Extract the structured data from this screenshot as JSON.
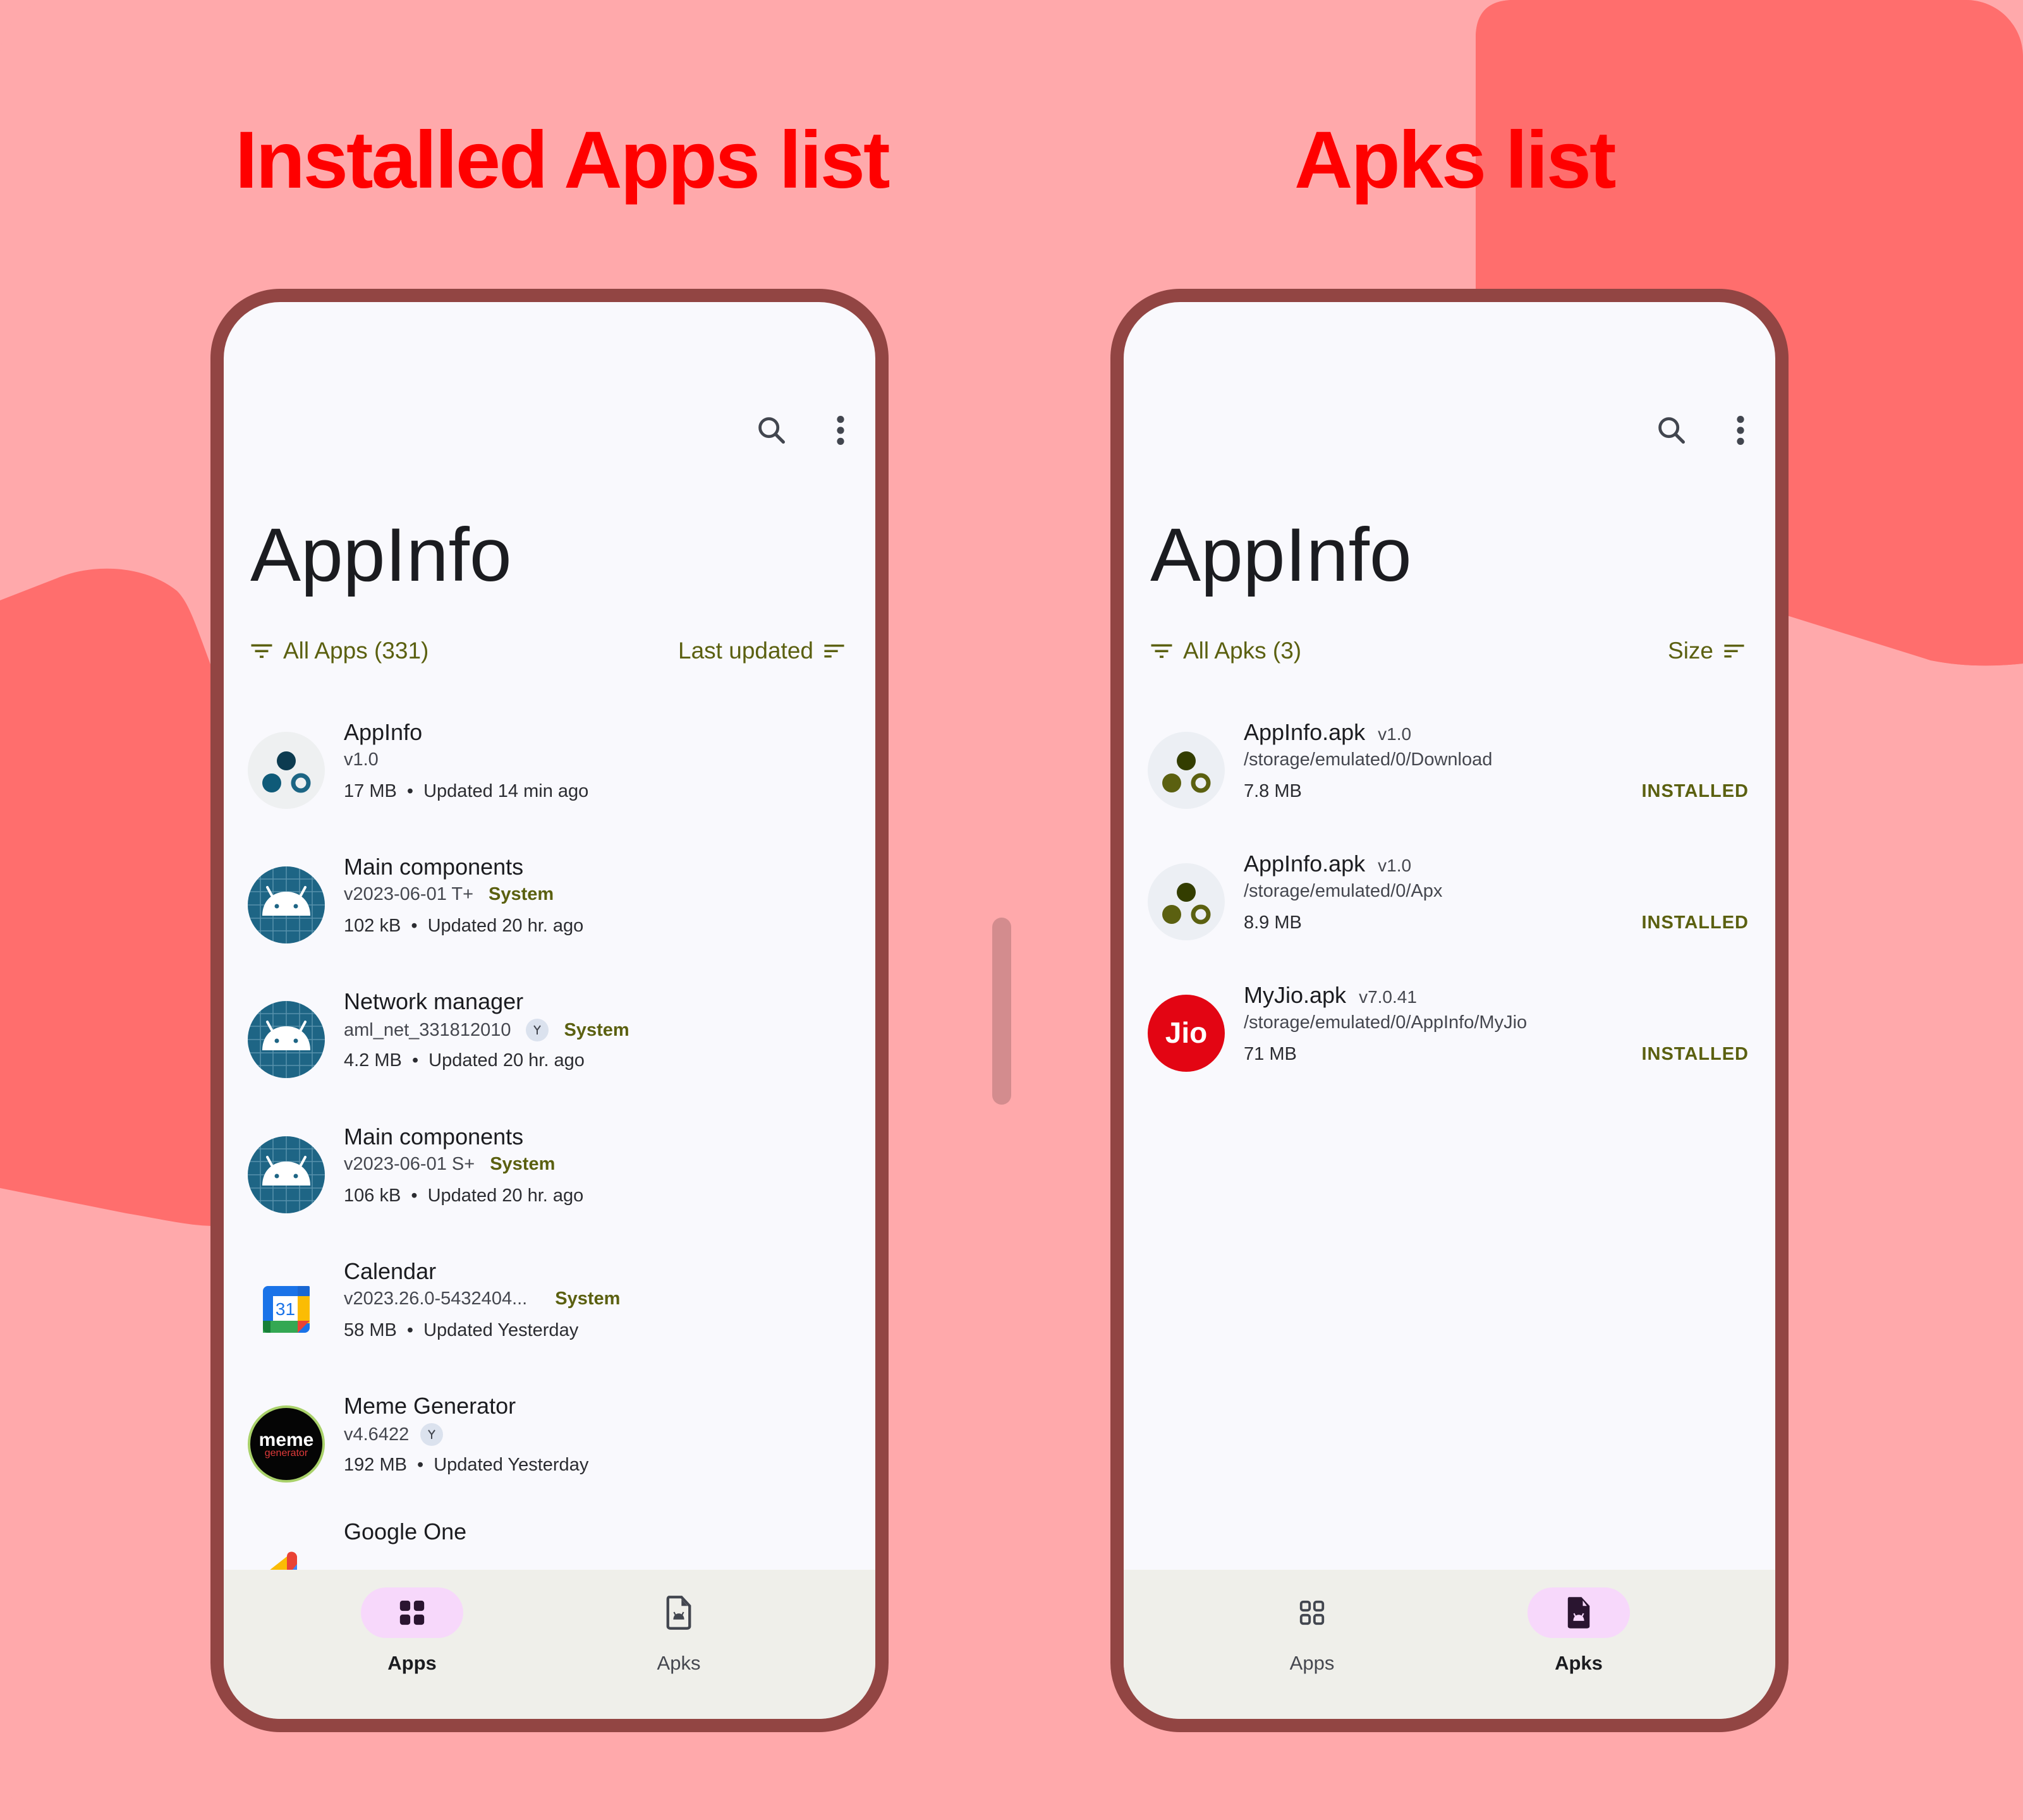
{
  "headings": {
    "left": "Installed Apps list",
    "right": "Apks list"
  },
  "colors": {
    "background": "#ffa9ab",
    "blob": "#ff6e6d",
    "heading": "#ff0000",
    "phone_frame": "#924543",
    "accent": "#5b6010",
    "nav_active": "#f7d8fb"
  },
  "phones": {
    "apps": {
      "app_title": "AppInfo",
      "toolbar": {
        "search_icon": "search-icon",
        "menu_icon": "more-vert-icon"
      },
      "filter_label": "All Apps (331)",
      "sort_label": "Last updated",
      "items": [
        {
          "name": "AppInfo",
          "version": "v1.0",
          "badge": "",
          "split": false,
          "size": "17 MB",
          "updated": "Updated 14 min ago",
          "icon": "appinfo-icon"
        },
        {
          "name": "Main components",
          "version": "v2023-06-01 T+",
          "badge": "System",
          "split": false,
          "size": "102 kB",
          "updated": "Updated 20 hr. ago",
          "icon": "android-icon"
        },
        {
          "name": "Network manager",
          "version": "aml_net_331812010",
          "badge": "System",
          "split": true,
          "size": "4.2 MB",
          "updated": "Updated 20 hr. ago",
          "icon": "android-icon"
        },
        {
          "name": "Main components",
          "version": "v2023-06-01 S+",
          "badge": "System",
          "split": false,
          "size": "106 kB",
          "updated": "Updated 20 hr. ago",
          "icon": "android-icon"
        },
        {
          "name": "Calendar",
          "version": "v2023.26.0-5432404...",
          "badge": "System",
          "split": false,
          "size": "58 MB",
          "updated": "Updated Yesterday",
          "icon": "google-calendar-icon"
        },
        {
          "name": "Meme Generator",
          "version": "v4.6422",
          "badge": "",
          "split": true,
          "size": "192 MB",
          "updated": "Updated Yesterday",
          "icon": "meme-generator-icon"
        },
        {
          "name": "Google One",
          "version": "",
          "badge": "",
          "split": false,
          "size": "",
          "updated": "",
          "icon": "google-one-icon"
        }
      ],
      "separator": "•",
      "nav": [
        {
          "label": "Apps",
          "active": true,
          "icon": "apps-grid-icon"
        },
        {
          "label": "Apks",
          "active": false,
          "icon": "apk-file-icon"
        }
      ]
    },
    "apks": {
      "app_title": "AppInfo",
      "toolbar": {
        "search_icon": "search-icon",
        "menu_icon": "more-vert-icon"
      },
      "filter_label": "All Apks (3)",
      "sort_label": "Size",
      "items": [
        {
          "name": "AppInfo.apk",
          "version": "v1.0",
          "path": "/storage/emulated/0/Download",
          "size": "7.8 MB",
          "status": "INSTALLED",
          "icon": "appinfo-icon"
        },
        {
          "name": "AppInfo.apk",
          "version": "v1.0",
          "path": "/storage/emulated/0/Apx",
          "size": "8.9 MB",
          "status": "INSTALLED",
          "icon": "appinfo-icon"
        },
        {
          "name": "MyJio.apk",
          "version": "v7.0.41",
          "path": "/storage/emulated/0/AppInfo/MyJio",
          "size": "71 MB",
          "status": "INSTALLED",
          "icon": "jio-icon"
        }
      ],
      "nav": [
        {
          "label": "Apps",
          "active": false,
          "icon": "apps-grid-icon"
        },
        {
          "label": "Apks",
          "active": true,
          "icon": "apk-file-icon"
        }
      ]
    }
  }
}
